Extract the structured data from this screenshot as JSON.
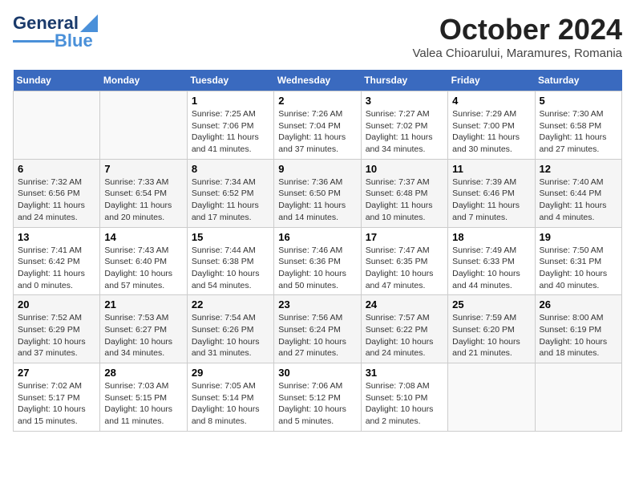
{
  "logo": {
    "line1": "General",
    "line2": "Blue"
  },
  "title": "October 2024",
  "location": "Valea Chioarului, Maramures, Romania",
  "days_of_week": [
    "Sunday",
    "Monday",
    "Tuesday",
    "Wednesday",
    "Thursday",
    "Friday",
    "Saturday"
  ],
  "weeks": [
    [
      {
        "num": "",
        "info": ""
      },
      {
        "num": "",
        "info": ""
      },
      {
        "num": "1",
        "info": "Sunrise: 7:25 AM\nSunset: 7:06 PM\nDaylight: 11 hours and 41 minutes."
      },
      {
        "num": "2",
        "info": "Sunrise: 7:26 AM\nSunset: 7:04 PM\nDaylight: 11 hours and 37 minutes."
      },
      {
        "num": "3",
        "info": "Sunrise: 7:27 AM\nSunset: 7:02 PM\nDaylight: 11 hours and 34 minutes."
      },
      {
        "num": "4",
        "info": "Sunrise: 7:29 AM\nSunset: 7:00 PM\nDaylight: 11 hours and 30 minutes."
      },
      {
        "num": "5",
        "info": "Sunrise: 7:30 AM\nSunset: 6:58 PM\nDaylight: 11 hours and 27 minutes."
      }
    ],
    [
      {
        "num": "6",
        "info": "Sunrise: 7:32 AM\nSunset: 6:56 PM\nDaylight: 11 hours and 24 minutes."
      },
      {
        "num": "7",
        "info": "Sunrise: 7:33 AM\nSunset: 6:54 PM\nDaylight: 11 hours and 20 minutes."
      },
      {
        "num": "8",
        "info": "Sunrise: 7:34 AM\nSunset: 6:52 PM\nDaylight: 11 hours and 17 minutes."
      },
      {
        "num": "9",
        "info": "Sunrise: 7:36 AM\nSunset: 6:50 PM\nDaylight: 11 hours and 14 minutes."
      },
      {
        "num": "10",
        "info": "Sunrise: 7:37 AM\nSunset: 6:48 PM\nDaylight: 11 hours and 10 minutes."
      },
      {
        "num": "11",
        "info": "Sunrise: 7:39 AM\nSunset: 6:46 PM\nDaylight: 11 hours and 7 minutes."
      },
      {
        "num": "12",
        "info": "Sunrise: 7:40 AM\nSunset: 6:44 PM\nDaylight: 11 hours and 4 minutes."
      }
    ],
    [
      {
        "num": "13",
        "info": "Sunrise: 7:41 AM\nSunset: 6:42 PM\nDaylight: 11 hours and 0 minutes."
      },
      {
        "num": "14",
        "info": "Sunrise: 7:43 AM\nSunset: 6:40 PM\nDaylight: 10 hours and 57 minutes."
      },
      {
        "num": "15",
        "info": "Sunrise: 7:44 AM\nSunset: 6:38 PM\nDaylight: 10 hours and 54 minutes."
      },
      {
        "num": "16",
        "info": "Sunrise: 7:46 AM\nSunset: 6:36 PM\nDaylight: 10 hours and 50 minutes."
      },
      {
        "num": "17",
        "info": "Sunrise: 7:47 AM\nSunset: 6:35 PM\nDaylight: 10 hours and 47 minutes."
      },
      {
        "num": "18",
        "info": "Sunrise: 7:49 AM\nSunset: 6:33 PM\nDaylight: 10 hours and 44 minutes."
      },
      {
        "num": "19",
        "info": "Sunrise: 7:50 AM\nSunset: 6:31 PM\nDaylight: 10 hours and 40 minutes."
      }
    ],
    [
      {
        "num": "20",
        "info": "Sunrise: 7:52 AM\nSunset: 6:29 PM\nDaylight: 10 hours and 37 minutes."
      },
      {
        "num": "21",
        "info": "Sunrise: 7:53 AM\nSunset: 6:27 PM\nDaylight: 10 hours and 34 minutes."
      },
      {
        "num": "22",
        "info": "Sunrise: 7:54 AM\nSunset: 6:26 PM\nDaylight: 10 hours and 31 minutes."
      },
      {
        "num": "23",
        "info": "Sunrise: 7:56 AM\nSunset: 6:24 PM\nDaylight: 10 hours and 27 minutes."
      },
      {
        "num": "24",
        "info": "Sunrise: 7:57 AM\nSunset: 6:22 PM\nDaylight: 10 hours and 24 minutes."
      },
      {
        "num": "25",
        "info": "Sunrise: 7:59 AM\nSunset: 6:20 PM\nDaylight: 10 hours and 21 minutes."
      },
      {
        "num": "26",
        "info": "Sunrise: 8:00 AM\nSunset: 6:19 PM\nDaylight: 10 hours and 18 minutes."
      }
    ],
    [
      {
        "num": "27",
        "info": "Sunrise: 7:02 AM\nSunset: 5:17 PM\nDaylight: 10 hours and 15 minutes."
      },
      {
        "num": "28",
        "info": "Sunrise: 7:03 AM\nSunset: 5:15 PM\nDaylight: 10 hours and 11 minutes."
      },
      {
        "num": "29",
        "info": "Sunrise: 7:05 AM\nSunset: 5:14 PM\nDaylight: 10 hours and 8 minutes."
      },
      {
        "num": "30",
        "info": "Sunrise: 7:06 AM\nSunset: 5:12 PM\nDaylight: 10 hours and 5 minutes."
      },
      {
        "num": "31",
        "info": "Sunrise: 7:08 AM\nSunset: 5:10 PM\nDaylight: 10 hours and 2 minutes."
      },
      {
        "num": "",
        "info": ""
      },
      {
        "num": "",
        "info": ""
      }
    ]
  ]
}
